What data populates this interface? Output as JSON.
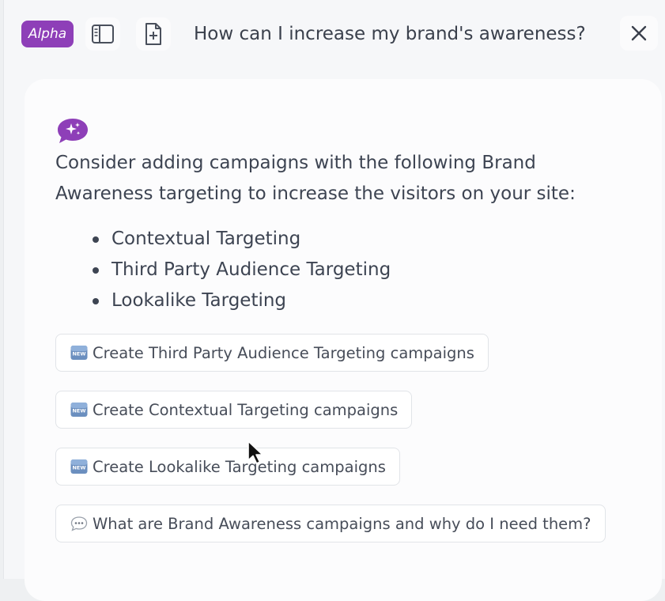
{
  "header": {
    "badge": "Alpha",
    "title": "How can I increase my brand's awareness?",
    "sidebar_toggle_icon": "sidebar-icon",
    "new_chat_icon": "new-document-icon",
    "close_icon": "close-icon"
  },
  "message": {
    "intro": "Consider adding campaigns with the following Brand Awareness targeting to increase the visitors on your site:",
    "bullets": [
      "Contextual Targeting",
      "Third Party Audience Targeting",
      "Lookalike Targeting"
    ]
  },
  "suggestions": [
    {
      "icon": "new-icon",
      "label": "Create Third Party Audience Targeting campaigns"
    },
    {
      "icon": "new-icon",
      "label": "Create Contextual Targeting campaigns"
    },
    {
      "icon": "new-icon",
      "label": "Create Lookalike Targeting campaigns"
    },
    {
      "icon": "chat-bubble-icon",
      "label": "What are Brand Awareness campaigns and why do I need them?"
    }
  ],
  "colors": {
    "accent": "#8e3fb8",
    "text": "#3d4452",
    "background": "#f6f7f9"
  }
}
